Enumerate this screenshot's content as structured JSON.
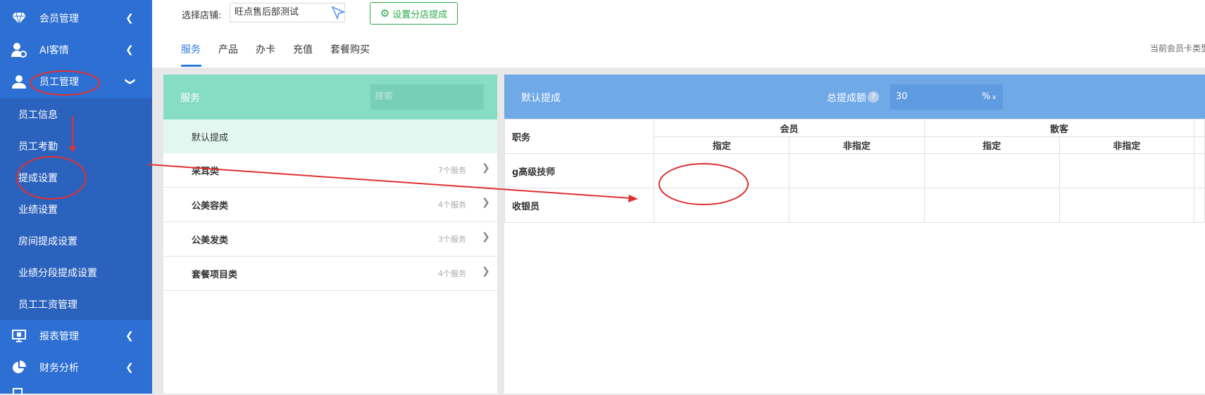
{
  "sidebar": {
    "items": [
      {
        "label": "会员管理",
        "icon": "diamond-icon"
      },
      {
        "label": "AI客情",
        "icon": "user-settings-icon"
      },
      {
        "label": "员工管理",
        "icon": "user-icon"
      }
    ],
    "submenu": [
      "员工信息",
      "员工考勤",
      "提成设置",
      "业绩设置",
      "房间提成设置",
      "业绩分段提成设置",
      "员工工资管理"
    ],
    "bottom_items": [
      {
        "label": "报表管理",
        "icon": "monitor-icon"
      },
      {
        "label": "财务分析",
        "icon": "pie-chart-icon"
      }
    ]
  },
  "topbar": {
    "store_label": "选择店铺:",
    "store_value": "旺点售后部测试",
    "branch_button": "设置分店提成",
    "tabs": [
      "服务",
      "产品",
      "办卡",
      "充值",
      "套餐购买"
    ],
    "active_tab": 0,
    "card_type_label": "当前会员卡类型"
  },
  "left_panel": {
    "title": "服务",
    "search_placeholder": "搜索",
    "default_label": "默认提成",
    "categories": [
      {
        "name": "采耳类",
        "count": "7个服务"
      },
      {
        "name": "公美容类",
        "count": "4个服务"
      },
      {
        "name": "公美发类",
        "count": "3个服务"
      },
      {
        "name": "套餐项目类",
        "count": "4个服务"
      }
    ]
  },
  "right_panel": {
    "title": "默认提成",
    "total_label": "总提成额",
    "total_value": "30",
    "total_unit": "%",
    "table": {
      "position_header": "职务",
      "groups": [
        "会员",
        "散客"
      ],
      "subheaders": [
        "指定",
        "非指定",
        "指定",
        "非指定"
      ],
      "rows": [
        "g高级技师",
        "收银员"
      ]
    }
  },
  "colors": {
    "sidebar": "#2d6fd3",
    "left_header": "#87dcc4",
    "right_header": "#6fa9e8",
    "accent_green": "#2eaa4a",
    "annotation_red": "#e03030"
  }
}
